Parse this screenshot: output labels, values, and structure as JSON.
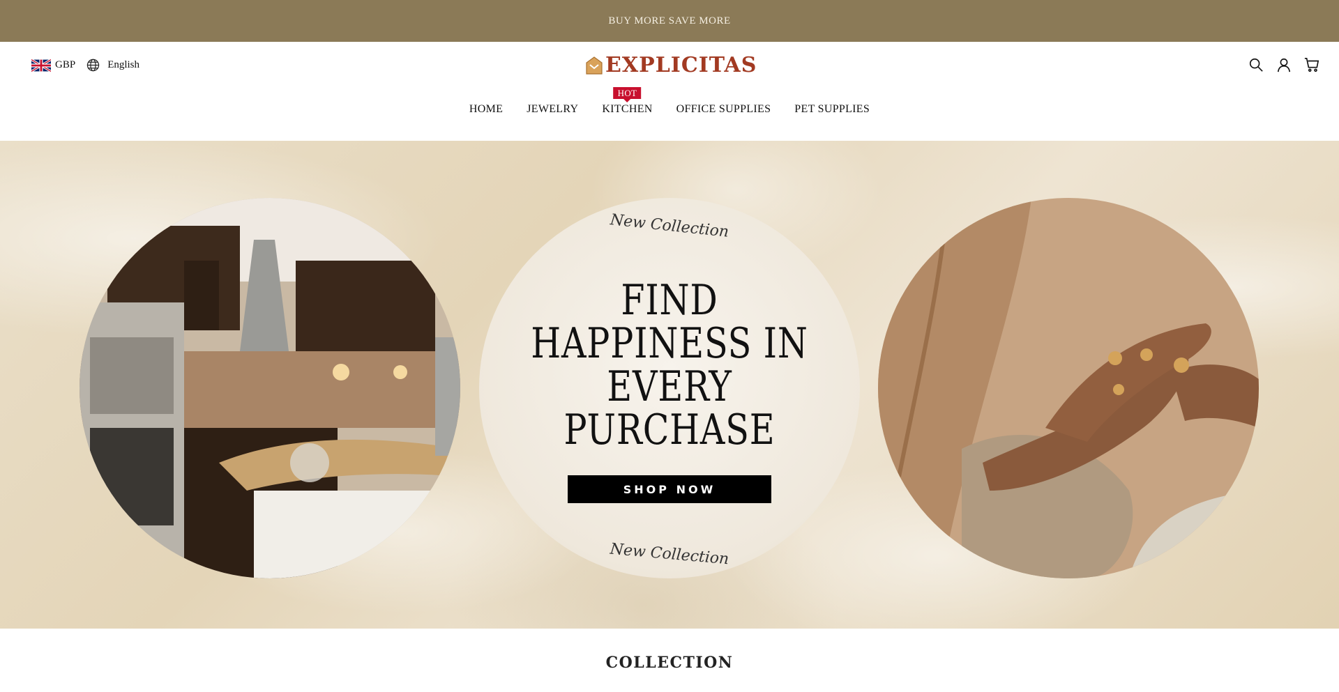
{
  "announcement": {
    "text": "BUY MORE SAVE MORE",
    "prefix_glyph": "",
    "suffix_glyph": ""
  },
  "header": {
    "currency": "GBP",
    "language": "English",
    "logo_text": "EXPLICITAS",
    "icons": [
      "search-icon",
      "account-icon",
      "cart-icon"
    ]
  },
  "nav": {
    "items": [
      {
        "label": "HOME"
      },
      {
        "label": "JEWELRY"
      },
      {
        "label": "KITCHEN",
        "badge": "HOT"
      },
      {
        "label": "OFFICE SUPPLIES"
      },
      {
        "label": "PET SUPPLIES"
      }
    ]
  },
  "hero": {
    "tagline_top": "New Collection",
    "headline_lines": [
      "FIND",
      "HAPPINESS IN",
      "EVERY",
      "PURCHASE"
    ],
    "cta_label": "SHOP NOW",
    "tagline_bottom": "New Collection"
  },
  "collection": {
    "title": "COLLECTION"
  },
  "colors": {
    "announcement_bg": "#8b7a57",
    "logo": "#a23a22",
    "hot_badge": "#c8102e",
    "cta_bg": "#000000"
  }
}
